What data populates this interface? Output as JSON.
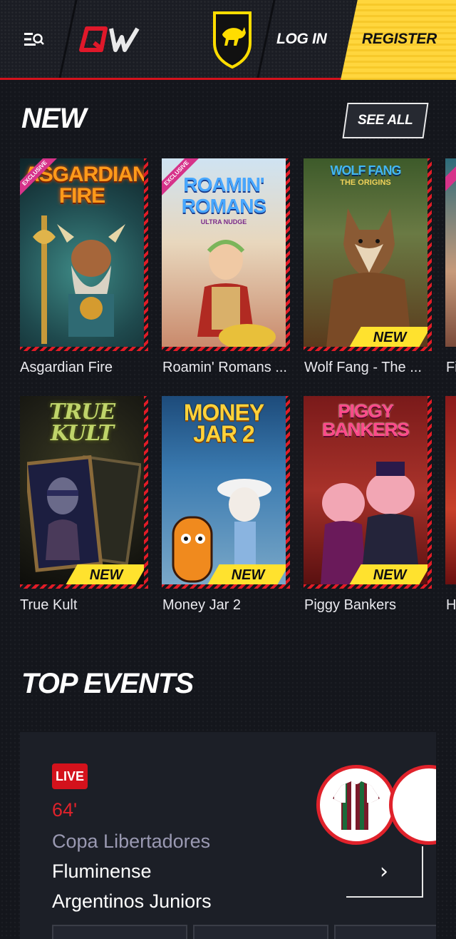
{
  "header": {
    "logo_text": "QW",
    "login_label": "LOG IN",
    "register_label": "REGISTER"
  },
  "new_section": {
    "title": "NEW",
    "see_all_label": "SEE ALL",
    "games": [
      {
        "name": "Asgardian Fire",
        "art_title": "ASGARDIAN FIRE",
        "exclusive": true,
        "new": false
      },
      {
        "name": "Roamin' Romans ...",
        "art_title": "ROAMIN' ROMANS",
        "art_subtitle": "ULTRA NUDGE",
        "exclusive": true,
        "new": false
      },
      {
        "name": "Wolf Fang - The ...",
        "art_title": "WOLF FANG",
        "art_subtitle": "THE ORIGINS",
        "exclusive": false,
        "new": true
      },
      {
        "name": "Fi",
        "art_title": "",
        "exclusive": true,
        "new": false
      },
      {
        "name": "True Kult",
        "art_title": "TRUE KULT",
        "exclusive": false,
        "new": true
      },
      {
        "name": "Money Jar 2",
        "art_title": "MONEY JAR 2",
        "exclusive": false,
        "new": true
      },
      {
        "name": "Piggy Bankers",
        "art_title": "PIGGY BANKERS",
        "exclusive": false,
        "new": true
      },
      {
        "name": "H",
        "art_title": "",
        "exclusive": false,
        "new": false
      }
    ],
    "exclusive_label": "EXCLUSIVE",
    "new_label": "NEW"
  },
  "top_events": {
    "title": "TOP EVENTS",
    "event": {
      "live_label": "LIVE",
      "minute": "64'",
      "league": "Copa Libertadores",
      "home_team": "Fluminense",
      "away_team": "Argentinos Juniors",
      "arrow": "›"
    }
  },
  "colors": {
    "accent_red": "#d4121c",
    "register_yellow": "#ffd63d",
    "new_tag_yellow": "#ffe22e",
    "league_gray": "#9a99b2"
  }
}
